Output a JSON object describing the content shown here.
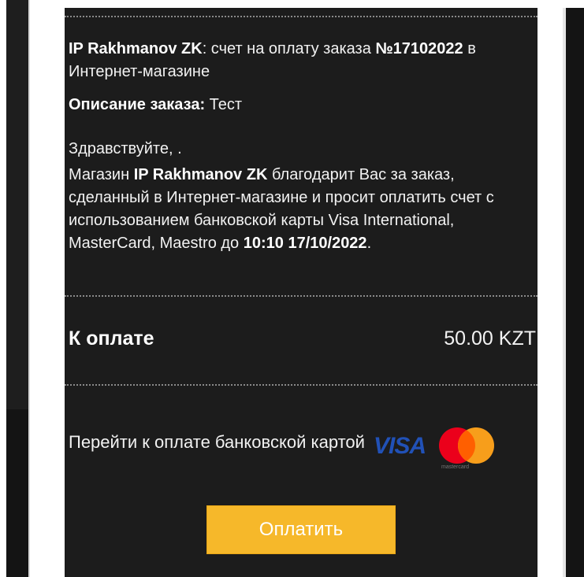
{
  "invoice": {
    "merchant": "IP Rakhmanov ZK",
    "header_text": ": счет на оплату заказа ",
    "order_number": "№17102022",
    "header_suffix": " в Интернет-магазине",
    "description_label": "Описание заказа:",
    "description_value": " Тест",
    "greeting": "Здравствуйте, .",
    "body_prefix": "Магазин ",
    "body_merchant": "IP Rakhmanov ZK",
    "body_text": " благодарит Вас за заказ, сделанный в Интернет-магазине и просит оплатить счет с использованием банковской карты Visa International, MasterCard, Maestro до ",
    "deadline": "10:10 17/10/2022",
    "body_end": "."
  },
  "total": {
    "label": "К оплате",
    "amount": "50.00 KZT"
  },
  "payment": {
    "prompt": "Перейти к оплате банковской картой",
    "visa_logo": "VISA",
    "mastercard_logo": "mastercard",
    "button_label": "Оплатить",
    "colors": {
      "button": "#f6b82a",
      "visa": "#2151b7",
      "mc_red": "#eb001b",
      "mc_orange": "#f79e1b"
    }
  }
}
